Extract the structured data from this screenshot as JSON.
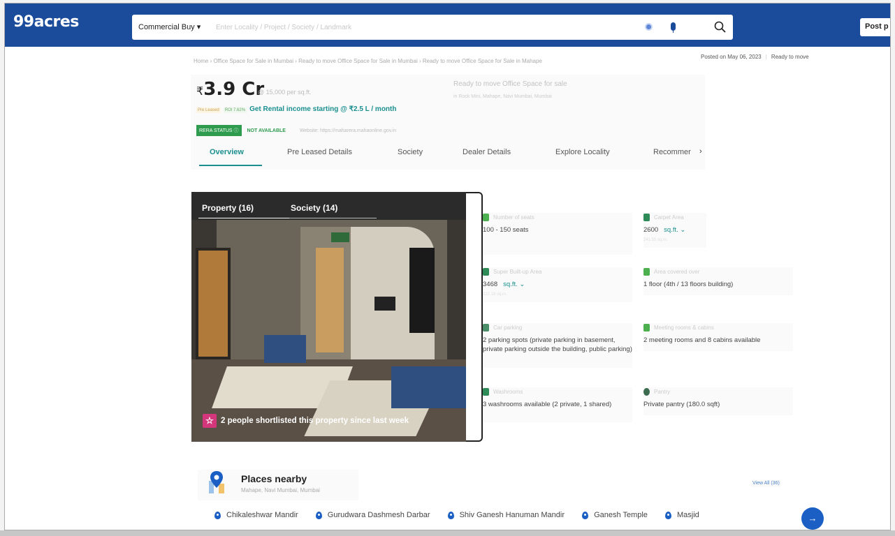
{
  "header": {
    "logo": "99acres",
    "search_category": "Commercial Buy ▾",
    "search_placeholder": "Enter Locality / Project / Society / Landmark",
    "post_label": "Post p"
  },
  "breadcrumb": "Home › Office Space for Sale in Mumbai › Ready to move Office Space for Sale in Mumbai › Ready to move Office Space for Sale in Mahape",
  "meta": {
    "posted": "Posted on May 06, 2023",
    "status": "Ready to move"
  },
  "listing": {
    "price_symbol": "₹",
    "price": "3.9 Cr",
    "price_per_sqft": "@ 15,000 per sq.ft.",
    "title": "Ready to move Office Space for sale",
    "subtitle": "in Rock Mini, Mahape, Navi Mumbai, Mumbai",
    "tag_preleased": "Pre Leased",
    "tag_roi": "ROI 7.62%",
    "rental_text": "Get Rental income starting @ ₹2.5 L / month",
    "rera_label": "RERA STATUS",
    "rera_status": "NOT AVAILABLE",
    "rera_website": "Website: https://maharera.mahaonline.gov.in"
  },
  "tabs": [
    "Overview",
    "Pre Leased Details",
    "Society",
    "Dealer Details",
    "Explore Locality",
    "Recommer"
  ],
  "tab_arrow": "›",
  "gallery": {
    "tab_property": "Property (16)",
    "tab_society": "Society (14)",
    "shortlist_text": "2 people shortlisted this property since last week",
    "star_icon": "☆"
  },
  "details": [
    {
      "label": "Number of seats",
      "value": "100 - 150 seats",
      "icon": "seat-icon",
      "color": "#4caf50"
    },
    {
      "label": "Carpet Area",
      "value": "2600",
      "unit": "sq.ft. ⌄",
      "extra": "241.55 sq.m.",
      "icon": "area-icon",
      "color": "#2e8b57"
    },
    {
      "label": "Super Built-up Area",
      "value": "3468",
      "unit": "sq.ft. ⌄",
      "extra": "322.19 sq.m.",
      "icon": "builtup-icon",
      "color": "#2e8b57"
    },
    {
      "label": "Area covered over",
      "value": "1 floor (4th / 13 floors building)",
      "icon": "floor-icon",
      "color": "#4caf50"
    },
    {
      "label": "Car parking",
      "value": "2 parking spots (private parking in basement, private parking outside the building, public parking)",
      "icon": "car-icon",
      "color": "#4a8f6a"
    },
    {
      "label": "Meeting rooms & cabins",
      "value": "2 meeting rooms and 8 cabins available",
      "icon": "meeting-icon",
      "color": "#4caf50"
    },
    {
      "label": "Washrooms",
      "value": "3 washrooms available (2 private, 1 shared)",
      "icon": "washroom-icon",
      "color": "#2e8b57"
    },
    {
      "label": "Pantry",
      "value": "Private pantry (180.0 sqft)",
      "icon": "pantry-icon",
      "color": "#3d6b4f"
    }
  ],
  "places": {
    "title": "Places nearby",
    "subtitle": "Mahape, Navi Mumbai, Mumbai",
    "view_all": "View All (36)",
    "items": [
      "Chikaleshwar Mandir",
      "Gurudwara Dashmesh Darbar",
      "Shiv Ganesh Hanuman Mandir",
      "Ganesh Temple",
      "Masjid"
    ],
    "next_arrow": "→"
  },
  "colors": {
    "brand": "#1b4c9c",
    "accent": "#1b8f8f",
    "rera_green": "#2e9b4e",
    "shortlist_pink": "#d3367a"
  }
}
